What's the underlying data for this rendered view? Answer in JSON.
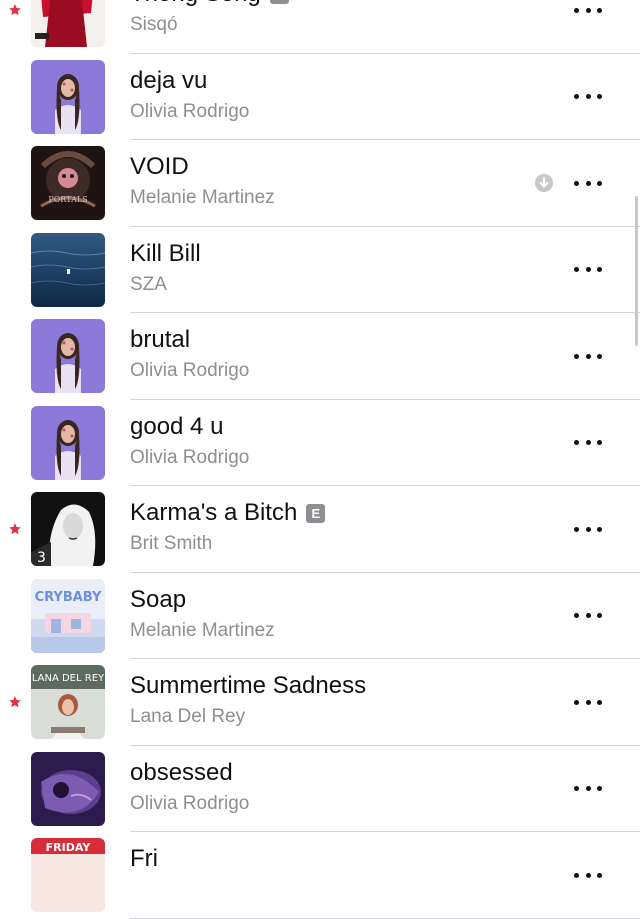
{
  "accent_color": "#e0324a",
  "songs": [
    {
      "title": "Thong Song",
      "artist": "Sisqó",
      "favorite": true,
      "explicit": true,
      "downloaded": false,
      "art": "thong"
    },
    {
      "title": "deja vu",
      "artist": "Olivia Rodrigo",
      "favorite": false,
      "explicit": false,
      "downloaded": false,
      "art": "sour"
    },
    {
      "title": "VOID",
      "artist": "Melanie Martinez",
      "favorite": false,
      "explicit": false,
      "downloaded": true,
      "art": "portals"
    },
    {
      "title": "Kill Bill",
      "artist": "SZA",
      "favorite": false,
      "explicit": false,
      "downloaded": false,
      "art": "sos"
    },
    {
      "title": "brutal",
      "artist": "Olivia Rodrigo",
      "favorite": false,
      "explicit": false,
      "downloaded": false,
      "art": "sour"
    },
    {
      "title": "good 4 u",
      "artist": "Olivia Rodrigo",
      "favorite": false,
      "explicit": false,
      "downloaded": false,
      "art": "sour"
    },
    {
      "title": "Karma's a Bitch",
      "artist": "Brit Smith",
      "favorite": true,
      "explicit": true,
      "downloaded": false,
      "art": "karma"
    },
    {
      "title": "Soap",
      "artist": "Melanie Martinez",
      "favorite": false,
      "explicit": false,
      "downloaded": false,
      "art": "crybaby"
    },
    {
      "title": "Summertime Sadness",
      "artist": "Lana Del Rey",
      "favorite": true,
      "explicit": false,
      "downloaded": false,
      "art": "lana"
    },
    {
      "title": "obsessed",
      "artist": "Olivia Rodrigo",
      "favorite": false,
      "explicit": false,
      "downloaded": false,
      "art": "guts"
    },
    {
      "title": "Fri",
      "artist": "",
      "favorite": false,
      "explicit": false,
      "downloaded": false,
      "art": "friday"
    }
  ],
  "explicit_label": "E",
  "art_text": {
    "crybaby": "CRYBABY",
    "lana": "LANA DEL REY",
    "friday": "FRIDAY"
  },
  "icons": {
    "favorite": "star-icon",
    "more": "ellipsis-icon",
    "download": "downloaded-icon"
  }
}
